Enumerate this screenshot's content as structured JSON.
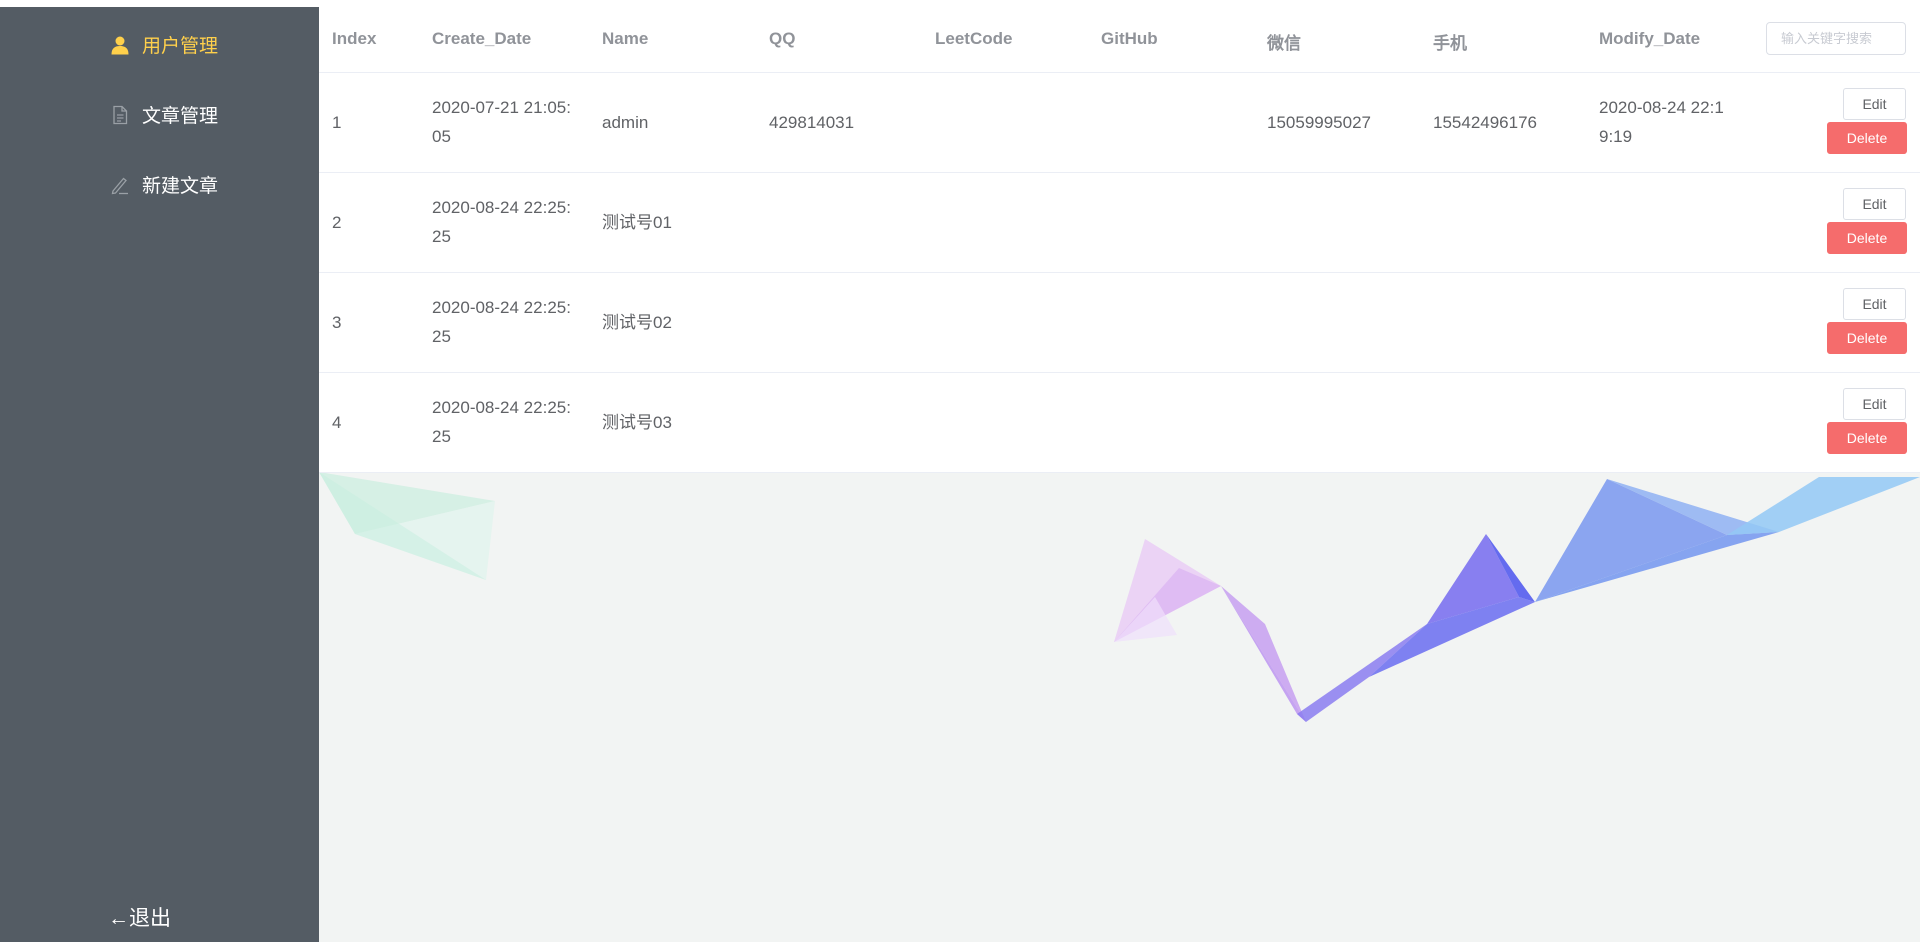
{
  "sidebar": {
    "items": [
      {
        "label": "用户管理",
        "icon": "user-icon",
        "active": true
      },
      {
        "label": "文章管理",
        "icon": "document-icon",
        "active": false
      },
      {
        "label": "新建文章",
        "icon": "edit-icon",
        "active": false
      }
    ],
    "logout_label": "←退出",
    "colors": {
      "background": "#545c64",
      "active": "#ffd04b",
      "text": "#ffffff"
    }
  },
  "table": {
    "headers": [
      "Index",
      "Create_Date",
      "Name",
      "QQ",
      "LeetCode",
      "GitHub",
      "微信",
      "手机",
      "Modify_Date"
    ],
    "search_placeholder": "输入关键字搜索",
    "rows": [
      {
        "index": "1",
        "create_date_1": "2020-07-21 21:05:",
        "create_date_2": "05",
        "name": "admin",
        "qq": "429814031",
        "leetcode": "",
        "github": "",
        "wechat": "15059995027",
        "phone": "15542496176",
        "modify_date_1": "2020-08-24 22:1",
        "modify_date_2": "9:19"
      },
      {
        "index": "2",
        "create_date_1": "2020-08-24 22:25:",
        "create_date_2": "25",
        "name": "测试号01",
        "qq": "",
        "leetcode": "",
        "github": "",
        "wechat": "",
        "phone": "",
        "modify_date_1": "",
        "modify_date_2": ""
      },
      {
        "index": "3",
        "create_date_1": "2020-08-24 22:25:",
        "create_date_2": "25",
        "name": "测试号02",
        "qq": "",
        "leetcode": "",
        "github": "",
        "wechat": "",
        "phone": "",
        "modify_date_1": "",
        "modify_date_2": ""
      },
      {
        "index": "4",
        "create_date_1": "2020-08-24 22:25:",
        "create_date_2": "25",
        "name": "测试号03",
        "qq": "",
        "leetcode": "",
        "github": "",
        "wechat": "",
        "phone": "",
        "modify_date_1": "",
        "modify_date_2": ""
      }
    ],
    "edit_label": "Edit",
    "delete_label": "Delete",
    "colors": {
      "delete": "#f56c6c",
      "header_text": "#909399"
    }
  }
}
